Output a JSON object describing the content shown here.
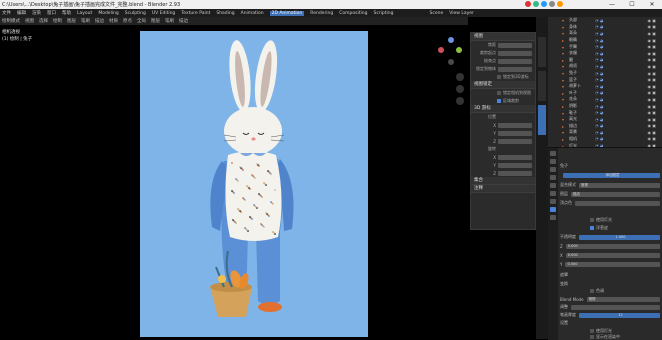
{
  "window": {
    "title": "C:\\Users\\...\\Desktop\\兔子插画\\兔子插画完成文件_完整.blend - Blender 2.93",
    "minimize": "—",
    "maximize": "☐",
    "close": "✕"
  },
  "menubar": {
    "items": [
      "文件",
      "编辑",
      "渲染",
      "窗口",
      "帮助",
      "Layout",
      "Modeling",
      "Sculpting",
      "UV Editing",
      "Texture Paint",
      "Shading",
      "Animation",
      "2D Animation",
      "Rendering",
      "Compositing",
      "Scripting"
    ],
    "active_index": 12,
    "scene": "Scene",
    "view_layer": "View Layer"
  },
  "toolbar": {
    "items": [
      "绘制模式",
      "视图",
      "选择",
      "绘制",
      "图层",
      "笔刷",
      "描边",
      "材质",
      "原点",
      "全局",
      "图层",
      "笔刷",
      "描边"
    ]
  },
  "viewport": {
    "mode_label": "相机透视",
    "object_label": "(1) 绘制 | 兔子"
  },
  "props": {
    "panel1_title": "视图",
    "rows1": [
      {
        "label": "焦距",
        "value": "50 mm"
      },
      {
        "label": "裁剪起点",
        "value": "0.01 m"
      },
      {
        "label": "结束点",
        "value": "1000 m"
      }
    ],
    "lock_label": "锁定到物体",
    "lock_cursor": "锁定到3D游标",
    "panel2_title": "3D 游标",
    "loc_label": "位置",
    "rot_label": "旋转",
    "axis": [
      "X",
      "Y",
      "Z"
    ],
    "panel3_title": "集合",
    "panel4_title": "注释",
    "panel5_title": "视图锁定",
    "check1": "锁定相机到视图",
    "check2": "区域裁剪"
  },
  "outliner": {
    "rows": [
      {
        "name": "头部",
        "expanded": true
      },
      {
        "name": "身体",
        "expanded": true
      },
      {
        "name": "耳朵",
        "expanded": true
      },
      {
        "name": "眼睛",
        "expanded": false
      },
      {
        "name": "手臂",
        "expanded": true
      },
      {
        "name": "衣服",
        "expanded": true
      },
      {
        "name": "腿",
        "expanded": false
      },
      {
        "name": "胡须",
        "expanded": true
      },
      {
        "name": "兔子",
        "expanded": true
      },
      {
        "name": "篮子",
        "expanded": true
      },
      {
        "name": "胡萝卜",
        "expanded": true
      },
      {
        "name": "叶子",
        "expanded": false
      },
      {
        "name": "花朵",
        "expanded": true
      },
      {
        "name": "阴影",
        "expanded": false
      },
      {
        "name": "鞋子",
        "expanded": true
      },
      {
        "name": "高光",
        "expanded": true
      },
      {
        "name": "描边",
        "expanded": false
      },
      {
        "name": "背景",
        "expanded": true
      },
      {
        "name": "相机",
        "expanded": false
      },
      {
        "name": "灯光",
        "expanded": false
      }
    ]
  },
  "propeditor": {
    "obj_name": "兔子",
    "layer_btn": "添加图层",
    "blend_label": "混合模式",
    "blend_value": "常规",
    "opacity_label": "不透明度",
    "opacity_value": "1.000",
    "use_lights": "使用灯光",
    "onion": "洋葱皮",
    "vertex_label": "顶点色",
    "rows": [
      {
        "label": "图层",
        "value": "描边"
      },
      {
        "label": "Z",
        "value": "0.000"
      },
      {
        "label": "X",
        "value": "0.000"
      },
      {
        "label": "Y",
        "value": "0.000"
      }
    ],
    "mask": "遮罩",
    "transform": "变换",
    "tint": "色调",
    "adjust": "调整",
    "settings": "设置",
    "blend2": "Blend Mode",
    "thickness": "笔画厚度",
    "stroke_val": "12",
    "check_a": "使用灯光",
    "check_b": "显示在渲染中"
  },
  "colors": {
    "canvas_bg": "#7eb4e8",
    "accent": "#4a84d8",
    "rabbit_white": "#f4f2ec",
    "rabbit_blue": "#5b8fd6",
    "ear_inner": "#c9b8b0",
    "shoe": "#e2712f",
    "basket": "#d4a25a"
  }
}
